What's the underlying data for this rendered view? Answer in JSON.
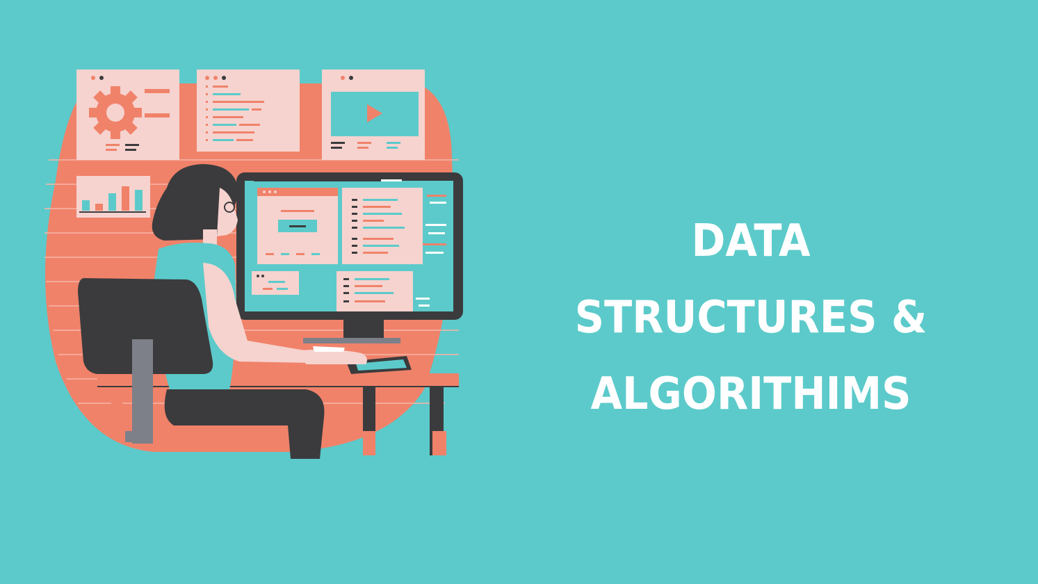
{
  "headline": {
    "line1": "DATA",
    "line2": "STRUCTURES &",
    "line3": "ALGORITHIMS"
  },
  "colors": {
    "background": "#5ccaca",
    "accent": "#f0826a",
    "panel": "#f6d3cf",
    "dark": "#3b3b3d",
    "text": "#ffffff"
  },
  "illustration": {
    "icons": [
      "gear-icon",
      "code-lines-icon",
      "video-play-icon",
      "bar-chart-icon",
      "monitor-icon",
      "chair-icon",
      "desk-icon",
      "person-icon"
    ]
  }
}
